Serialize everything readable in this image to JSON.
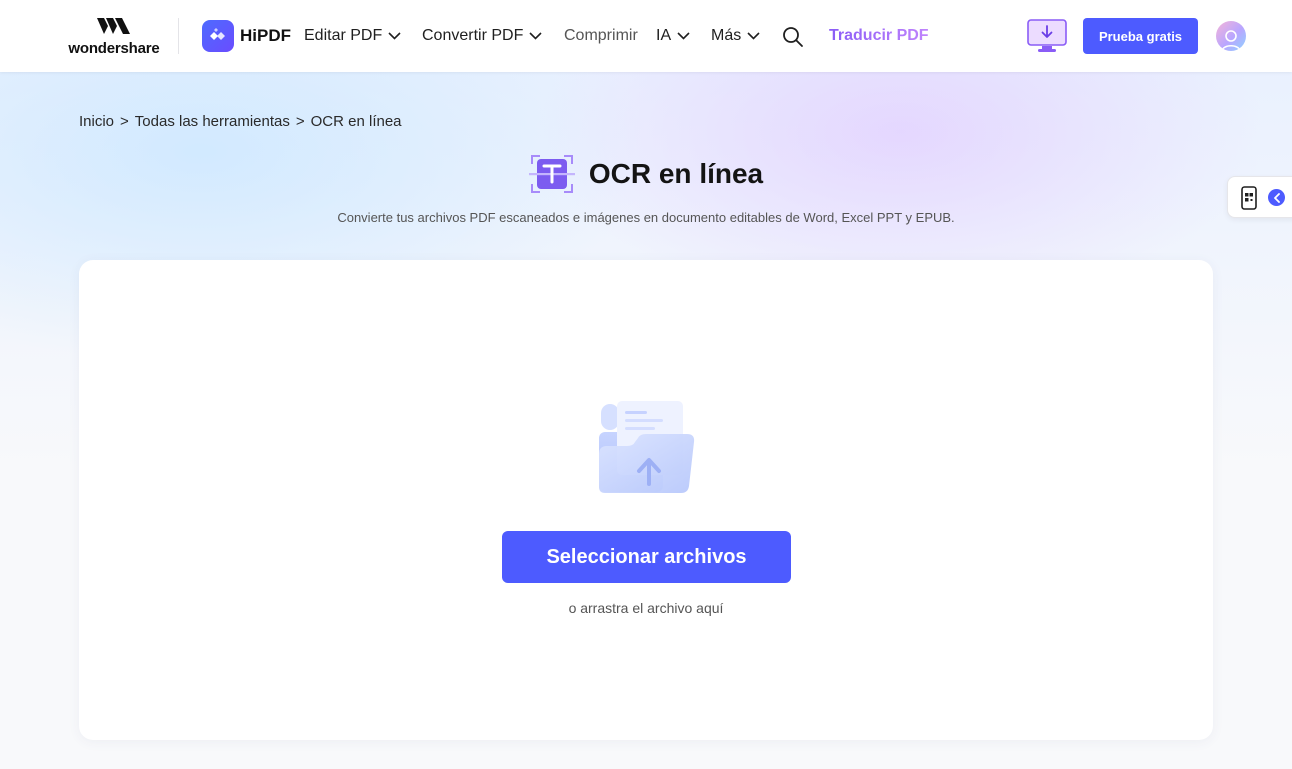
{
  "header": {
    "brand": {
      "wondershare": "wondershare",
      "hipdf": "HiPDF"
    },
    "nav": {
      "edit": "Editar PDF",
      "convert": "Convertir PDF",
      "compress": "Comprimir",
      "ai": "IA",
      "more": "Más",
      "translate": "Traducir PDF"
    },
    "trial_button": "Prueba gratis",
    "icons": [
      "wondershare-logo-icon",
      "hipdf-logo-icon",
      "chevron-down-icon",
      "search-icon",
      "desktop-download-icon",
      "avatar-icon"
    ]
  },
  "breadcrumb": {
    "home": "Inicio",
    "all_tools": "Todas las herramientas",
    "current": "OCR en línea",
    "separator": ">"
  },
  "hero": {
    "title": "OCR en línea",
    "subtitle": "Convierte tus archivos PDF escaneados e imágenes en documento editables de Word, Excel PPT y EPUB.",
    "icon": "ocr-text-icon"
  },
  "upload": {
    "button_label": "Seleccionar archivos",
    "hint": "o arrastra el archivo aquí",
    "icon": "folder-upload-icon"
  },
  "side_widget": {
    "icons": [
      "mobile-qr-icon",
      "chevron-left-icon"
    ]
  },
  "colors": {
    "primary": "#4d5bff",
    "accent_gradient_start": "#8a5cf6",
    "accent_gradient_end": "#c084fc",
    "text_dark": "#141414",
    "text_muted": "#555555"
  }
}
